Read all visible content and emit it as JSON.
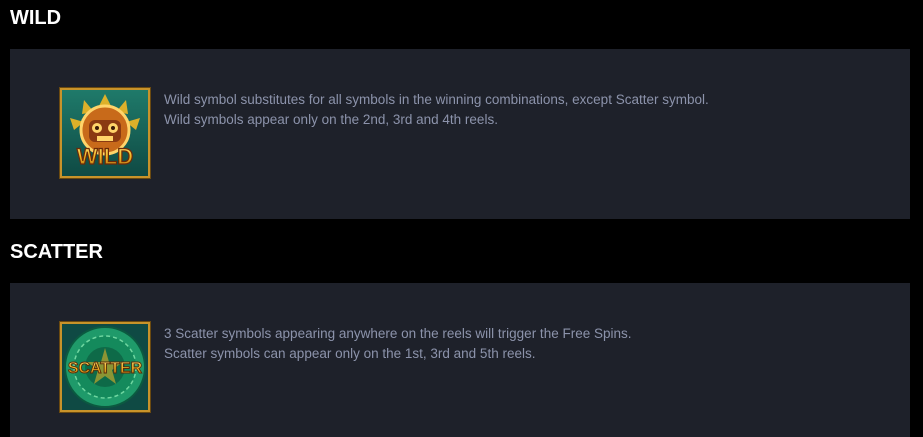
{
  "sections": [
    {
      "title": "WILD",
      "icon": "wild-symbol-icon",
      "icon_text": "WILD",
      "lines": [
        "Wild symbol substitutes for all symbols in the winning combinations, except Scatter symbol.",
        "Wild symbols appear only on the 2nd, 3rd and 4th reels."
      ]
    },
    {
      "title": "SCATTER",
      "icon": "scatter-symbol-icon",
      "icon_text": "SCATTER",
      "lines": [
        "3 Scatter symbols appearing anywhere on the reels will trigger the Free Spins.",
        "Scatter symbols can appear only on the 1st, 3rd and 5th reels."
      ]
    }
  ],
  "colors": {
    "background": "#000000",
    "card": "#1e212a",
    "title": "#ffffff",
    "text": "#8c93ab",
    "gold": "#f2b824",
    "jade": "#1f9a6a"
  }
}
